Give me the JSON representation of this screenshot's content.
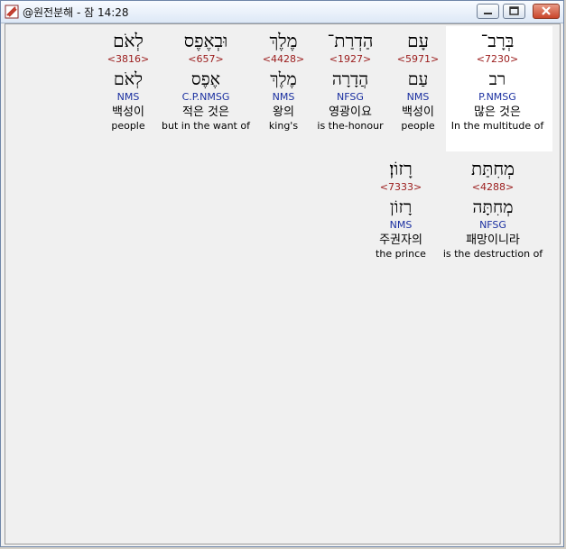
{
  "window": {
    "title": "@원전분해 - 잠 14:28"
  },
  "rows": [
    {
      "words": [
        {
          "hebrew": "בְּרָב־",
          "strong": "<7230>",
          "lemma": "רב",
          "parse": "P.NMSG",
          "korean": "많은 것은",
          "english": "In the multitude of",
          "highlighted": true
        },
        {
          "hebrew": "עָם",
          "strong": "<5971>",
          "lemma": "עַם",
          "parse": "NMS",
          "korean": "백성이",
          "english": "people"
        },
        {
          "hebrew": "הַדְרַת־",
          "strong": "<1927>",
          "lemma": "הֲדָרָה",
          "parse": "NFSG",
          "korean": "영광이요",
          "english": "is the-honour"
        },
        {
          "hebrew": "מֶלֶךְ",
          "strong": "<4428>",
          "lemma": "מֶלֶךְ",
          "parse": "NMS",
          "korean": "왕의",
          "english": "king's"
        },
        {
          "hebrew": "וּבְאֶפֶס",
          "strong": "<657>",
          "lemma": "אֶפֶס",
          "parse": "C.P.NMSG",
          "korean": "적은 것은",
          "english": "but in the want of"
        },
        {
          "hebrew": "לְאֹם",
          "strong": "<3816>",
          "lemma": "לְאֹם",
          "parse": "NMS",
          "korean": "백성이",
          "english": "people"
        }
      ]
    },
    {
      "words": [
        {
          "hebrew": "מְחִתַּת",
          "strong": "<4288>",
          "lemma": "מְחִתָּה",
          "parse": "NFSG",
          "korean": "패망이니라",
          "english": "is the destruction of"
        },
        {
          "hebrew": "רָזוֹן׃",
          "strong": "<7333>",
          "lemma": "רָזוֹן",
          "parse": "NMS",
          "korean": "주권자의",
          "english": "the prince"
        }
      ]
    }
  ]
}
